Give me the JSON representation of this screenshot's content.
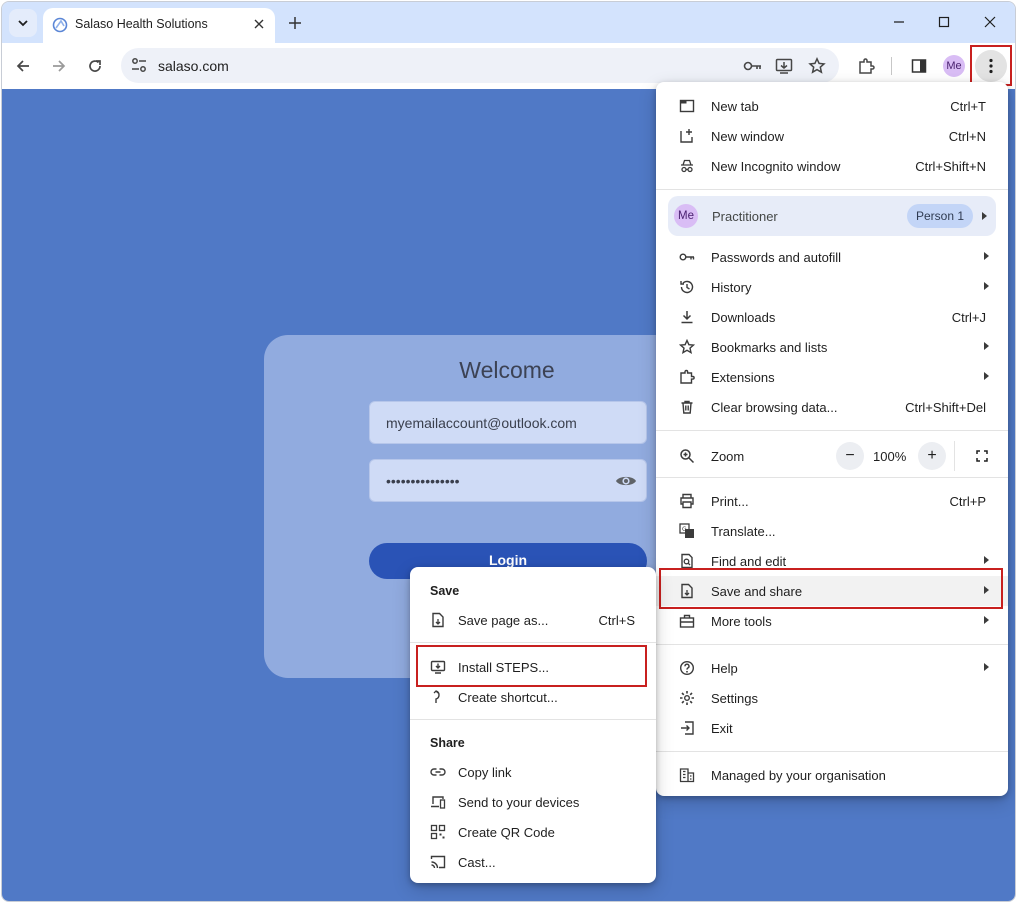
{
  "browser": {
    "tab_title": "Salaso Health Solutions",
    "url": "salaso.com",
    "profile_avatar": "Me"
  },
  "page": {
    "welcome": "Welcome",
    "email_value": "myemailaccount@outlook.com",
    "password_value": "•••••••••••••••",
    "login_label": "Login"
  },
  "main_menu": {
    "new_tab": {
      "label": "New tab",
      "shortcut": "Ctrl+T"
    },
    "new_window": {
      "label": "New window",
      "shortcut": "Ctrl+N"
    },
    "new_incognito": {
      "label": "New Incognito window",
      "shortcut": "Ctrl+Shift+N"
    },
    "profile": {
      "avatar": "Me",
      "name": "Practitioner",
      "badge": "Person 1"
    },
    "passwords": {
      "label": "Passwords and autofill"
    },
    "history": {
      "label": "History"
    },
    "downloads": {
      "label": "Downloads",
      "shortcut": "Ctrl+J"
    },
    "bookmarks": {
      "label": "Bookmarks and lists"
    },
    "extensions": {
      "label": "Extensions"
    },
    "clear_data": {
      "label": "Clear browsing data...",
      "shortcut": "Ctrl+Shift+Del"
    },
    "zoom": {
      "label": "Zoom",
      "minus": "−",
      "value": "100%",
      "plus": "+"
    },
    "print": {
      "label": "Print...",
      "shortcut": "Ctrl+P"
    },
    "translate": {
      "label": "Translate..."
    },
    "find_edit": {
      "label": "Find and edit"
    },
    "save_share": {
      "label": "Save and share"
    },
    "more_tools": {
      "label": "More tools"
    },
    "help": {
      "label": "Help"
    },
    "settings": {
      "label": "Settings"
    },
    "exit": {
      "label": "Exit"
    },
    "managed": {
      "label": "Managed by your organisation"
    }
  },
  "sub_menu": {
    "save_heading": "Save",
    "save_page": {
      "label": "Save page as...",
      "shortcut": "Ctrl+S"
    },
    "install": {
      "label": "Install STEPS..."
    },
    "create_shortcut": {
      "label": "Create shortcut..."
    },
    "share_heading": "Share",
    "copy_link": {
      "label": "Copy link"
    },
    "send_devices": {
      "label": "Send to your devices"
    },
    "qr_code": {
      "label": "Create QR Code"
    },
    "cast": {
      "label": "Cast..."
    }
  },
  "colors": {
    "page_bg": "#5079c6",
    "card_bg": "#91abdf",
    "login_button": "#2a53b6",
    "highlight": "#c8201f",
    "tabstrip": "#d3e3fd"
  }
}
